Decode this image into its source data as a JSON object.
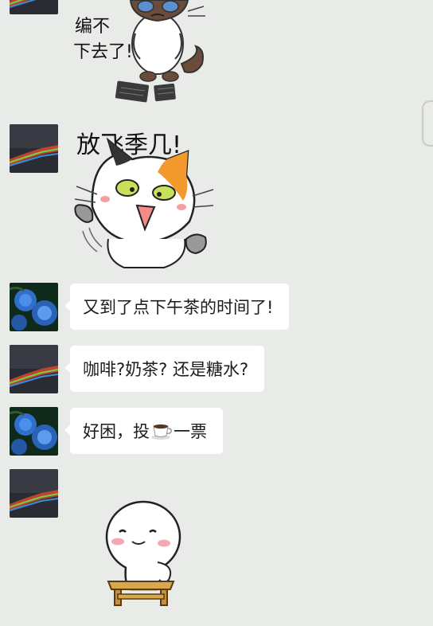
{
  "messages": [
    {
      "type": "sticker",
      "avatar": "sunset-avatar",
      "sticker_text": "编不下去了!",
      "sticker_icon": "grumpy-cat-sticker-icon"
    },
    {
      "type": "sticker",
      "avatar": "sunset-avatar",
      "sticker_text": "放飞季几!",
      "sticker_icon": "calico-cat-sticker-icon"
    },
    {
      "type": "text",
      "avatar": "blue-rose-avatar",
      "text": "又到了点下午茶的时间了!"
    },
    {
      "type": "text",
      "avatar": "sunset-avatar",
      "text": "咖啡?奶茶? 还是糖水?"
    },
    {
      "type": "text",
      "avatar": "blue-rose-avatar",
      "text_before_icon": "好困，投",
      "icon": "coffee-cup-icon",
      "text_after_icon": "一票"
    },
    {
      "type": "sticker",
      "avatar": "sunset-avatar",
      "sticker_icon": "bean-mascot-on-bench-sticker-icon"
    }
  ],
  "colors": {
    "chat_background": "#e9ebe8",
    "bubble_background": "#ffffff",
    "text": "#1c1c1c"
  }
}
